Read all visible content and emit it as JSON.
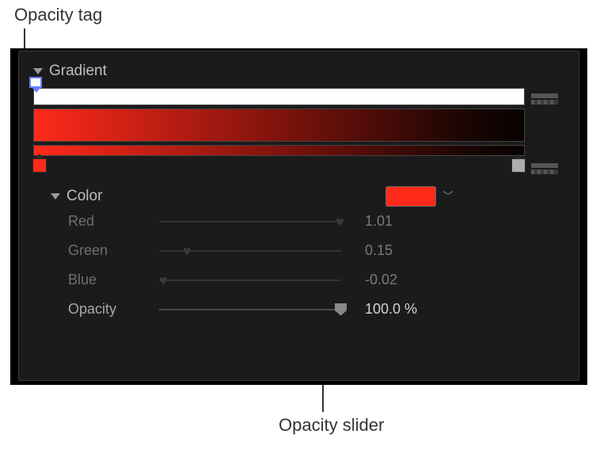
{
  "annotations": {
    "opacity_tag": "Opacity tag",
    "opacity_slider": "Opacity slider"
  },
  "panel": {
    "title": "Gradient"
  },
  "color_section": {
    "title": "Color",
    "swatch_hex": "#ff2a1a",
    "params": {
      "red": {
        "label": "Red",
        "value": "1.01",
        "pos": 0.99
      },
      "green": {
        "label": "Green",
        "value": "0.15",
        "pos": 0.15
      },
      "blue": {
        "label": "Blue",
        "value": "-0.02",
        "pos": 0.0
      },
      "opacity": {
        "label": "Opacity",
        "value": "100.0 %",
        "pos": 1.0
      }
    }
  }
}
